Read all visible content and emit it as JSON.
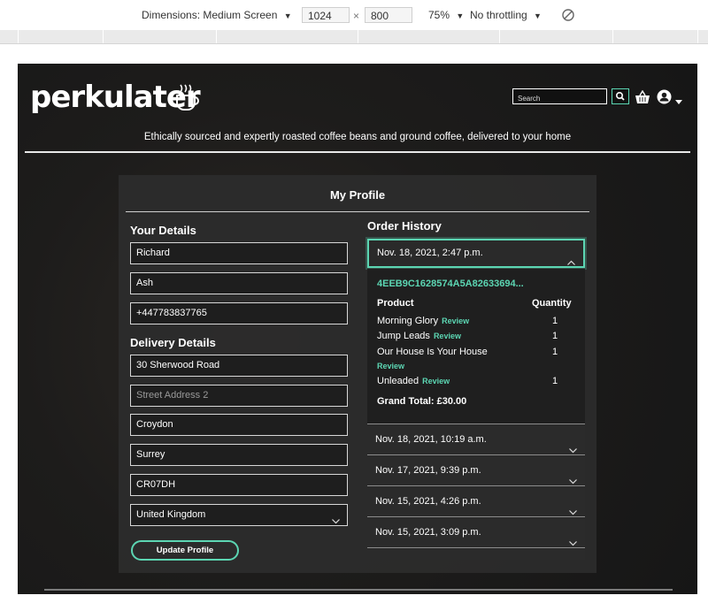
{
  "devtools": {
    "dimensions_label": "Dimensions: Medium Screen",
    "width": "1024",
    "times": "×",
    "height": "800",
    "zoom": "75%",
    "throttling": "No throttling"
  },
  "site": {
    "logo": "perkulater",
    "search_placeholder": "Search",
    "tagline": "Ethically sourced and expertly roasted coffee beans and ground coffee, delivered to your home",
    "accent": "#5cd6b3"
  },
  "profile": {
    "title": "My Profile",
    "your_details_heading": "Your Details",
    "first_name": "Richard",
    "last_name": "Ash",
    "phone": "+447783837765",
    "delivery_heading": "Delivery Details",
    "street1": "30 Sherwood Road",
    "street2_placeholder": "Street Address 2",
    "town": "Croydon",
    "county": "Surrey",
    "postcode": "CR07DH",
    "country": "United Kingdom",
    "update_button": "Update Profile"
  },
  "orders": {
    "heading": "Order History",
    "open_order": {
      "date": "Nov. 18, 2021, 2:47 p.m.",
      "number": "4EEB9C1628574A5A82633694...",
      "product_header": "Product",
      "quantity_header": "Quantity",
      "review_label": "Review",
      "items": [
        {
          "name": "Morning Glory",
          "qty": "1"
        },
        {
          "name": "Jump Leads",
          "qty": "1"
        },
        {
          "name": "Our House Is Your House",
          "qty": "1"
        },
        {
          "name": "Unleaded",
          "qty": "1"
        }
      ],
      "grand_total": "Grand Total: £30.00"
    },
    "others": [
      "Nov. 18, 2021, 10:19 a.m.",
      "Nov. 17, 2021, 9:39 p.m.",
      "Nov. 15, 2021, 4:26 p.m.",
      "Nov. 15, 2021, 3:09 p.m."
    ]
  }
}
